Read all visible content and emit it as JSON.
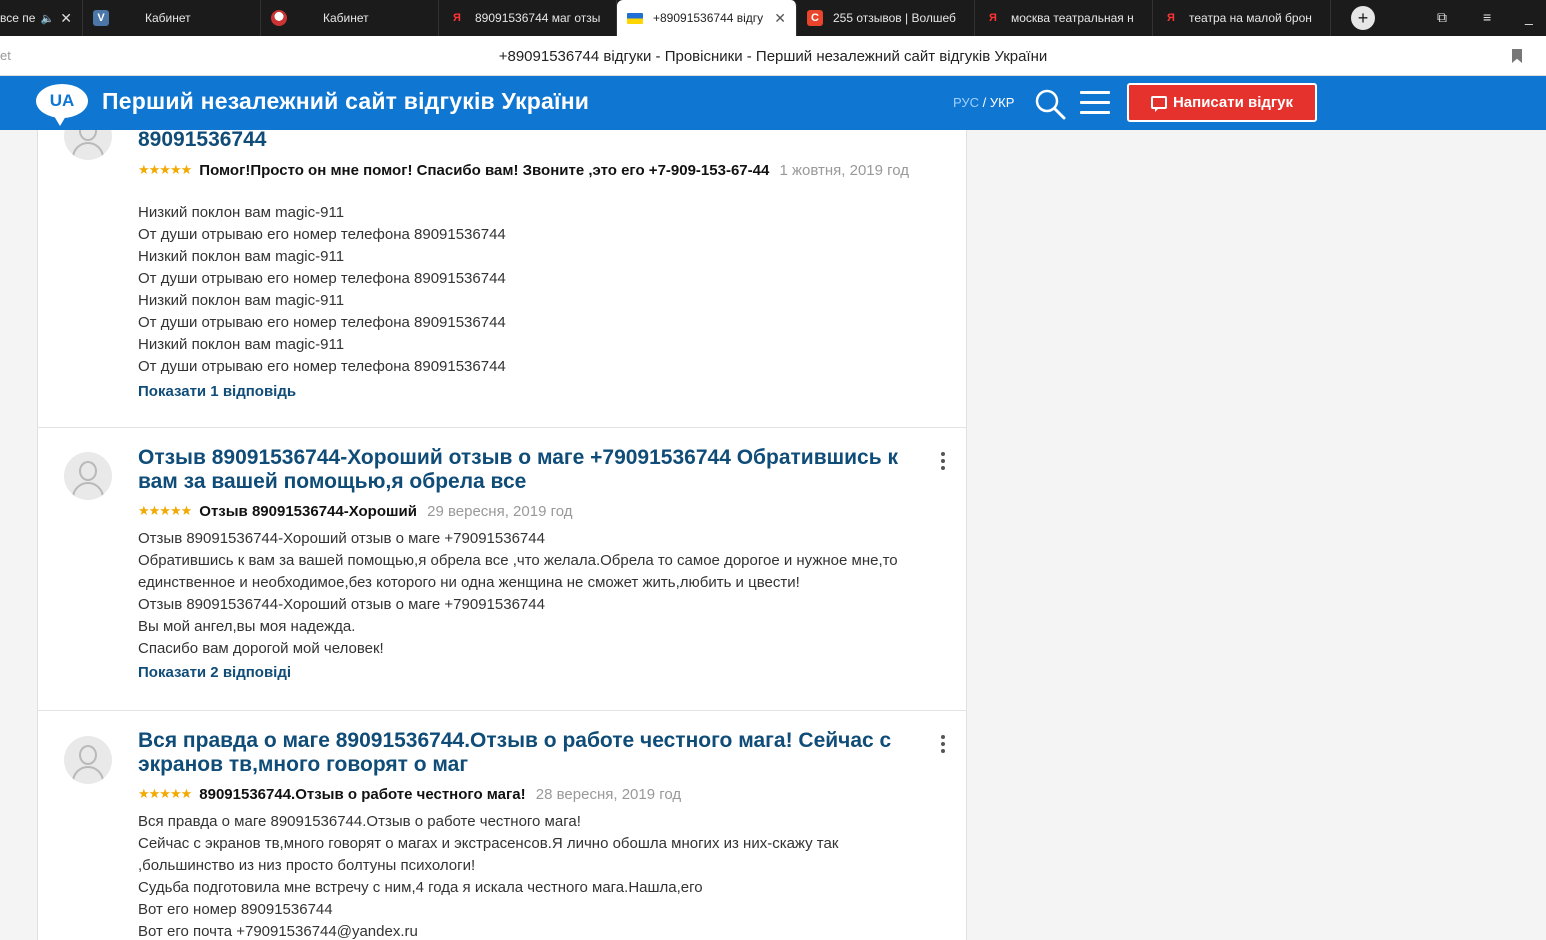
{
  "browser": {
    "tabs": [
      {
        "title": "все пе",
        "favicon": "speaker-icon",
        "muted_indicator": "🔈",
        "active": false
      },
      {
        "title": "Кабинет",
        "favicon": "vk-icon",
        "active": false
      },
      {
        "title": "Кабинет",
        "favicon": "circle-logo-icon",
        "active": false
      },
      {
        "title": "89091536744 маг отзы",
        "favicon": "yandex-icon",
        "active": false
      },
      {
        "title": "+89091536744 відгу",
        "favicon": "ukraine-flag-icon",
        "active": true
      },
      {
        "title": "255 отзывов | Волшеб",
        "favicon": "c-logo-icon",
        "active": false
      },
      {
        "title": "москва театральная н",
        "favicon": "yandex-icon",
        "active": false
      },
      {
        "title": "театра на малой брон",
        "favicon": "yandex-icon",
        "active": false
      }
    ],
    "new_tab_symbol": "+",
    "address_left": "et",
    "page_title": "+89091536744 відгуки - Провісники - Перший незалежний сайт відгуків України"
  },
  "header": {
    "logo_text": "UA",
    "site_title": "Перший незалежний сайт відгуків України",
    "lang_ru": "РУС",
    "lang_sep": " / ",
    "lang_uk": "УКР",
    "write_button": "Написати відгук",
    "colors": {
      "brand": "#0f76d2",
      "cta": "#e5322d"
    }
  },
  "reviews": [
    {
      "title": "89091536744",
      "stars": "★★★★★",
      "headline": "Помог!Просто он мне помог! Спасибо вам! Звоните ,это его +7-909-153-67-44",
      "date": "1 жовтня, 2019 год",
      "body": [
        "Низкий поклон вам magic-911",
        "От души отрываю его номер телефона 89091536744",
        "Низкий поклон вам magic-911",
        "От души отрываю его номер телефона 89091536744",
        "Низкий поклон вам magic-911",
        "От души отрываю его номер телефона 89091536744",
        "Низкий поклон вам magic-911",
        "От души отрываю его номер телефона 89091536744"
      ],
      "replies_link": "Показати 1 відповідь"
    },
    {
      "title": "Отзыв 89091536744-Хороший отзыв о маге +79091536744 Обратившись к вам за вашей помощью,я обрела все",
      "stars": "★★★★★",
      "headline": "Отзыв 89091536744-Хороший",
      "date": "29 вересня, 2019 год",
      "body": [
        "Отзыв 89091536744-Хороший отзыв о маге +79091536744",
        "Обратившись к вам за вашей помощью,я обрела все ,что желала.Обрела то самое дорогое и нужное мне,то единственное и необходимое,без которого ни одна женщина не сможет жить,любить и цвести!",
        "Отзыв 89091536744-Хороший отзыв о маге +79091536744",
        "Вы мой ангел,вы моя надежда.",
        "Спасибо вам дорогой мой человек!"
      ],
      "replies_link": "Показати 2 відповіді"
    },
    {
      "title": "Вся правда о маге 89091536744.Отзыв о работе честного мага! Сейчас с экранов тв,много говорят о маг",
      "stars": "★★★★★",
      "headline": "89091536744.Отзыв о работе честного мага!",
      "date": "28 вересня, 2019 год",
      "body": [
        "Вся правда о маге 89091536744.Отзыв о работе честного мага!",
        "Сейчас с экранов тв,много говорят о магах и экстрасенсов.Я лично обошла многих из них-скажу так ,большинство из низ просто болтуны психологи!",
        "Судьба подготовила мне встречу с ним,4 года я искала честного мага.Нашла,его",
        "Вот его номер 89091536744",
        "Вот его почта +79091536744@yandex.ru"
      ],
      "replies_link": ""
    }
  ]
}
